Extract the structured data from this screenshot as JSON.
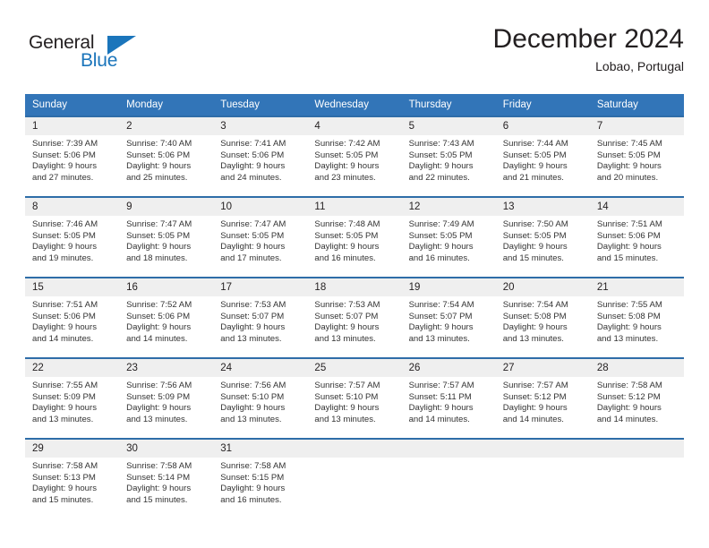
{
  "brand": {
    "name_part1": "General",
    "name_part2": "Blue"
  },
  "header": {
    "title": "December 2024",
    "location": "Lobao, Portugal"
  },
  "calendar": {
    "weekday_headers": [
      "Sunday",
      "Monday",
      "Tuesday",
      "Wednesday",
      "Thursday",
      "Friday",
      "Saturday"
    ],
    "colors": {
      "header_blue": "#3275b8",
      "row_divider_blue": "#2e6da8",
      "daynum_band": "#efefef",
      "brand_blue": "#1b75bb"
    },
    "weeks": [
      [
        {
          "day": "1",
          "sunrise": "Sunrise: 7:39 AM",
          "sunset": "Sunset: 5:06 PM",
          "daylight_line1": "Daylight: 9 hours",
          "daylight_line2": "and 27 minutes."
        },
        {
          "day": "2",
          "sunrise": "Sunrise: 7:40 AM",
          "sunset": "Sunset: 5:06 PM",
          "daylight_line1": "Daylight: 9 hours",
          "daylight_line2": "and 25 minutes."
        },
        {
          "day": "3",
          "sunrise": "Sunrise: 7:41 AM",
          "sunset": "Sunset: 5:06 PM",
          "daylight_line1": "Daylight: 9 hours",
          "daylight_line2": "and 24 minutes."
        },
        {
          "day": "4",
          "sunrise": "Sunrise: 7:42 AM",
          "sunset": "Sunset: 5:05 PM",
          "daylight_line1": "Daylight: 9 hours",
          "daylight_line2": "and 23 minutes."
        },
        {
          "day": "5",
          "sunrise": "Sunrise: 7:43 AM",
          "sunset": "Sunset: 5:05 PM",
          "daylight_line1": "Daylight: 9 hours",
          "daylight_line2": "and 22 minutes."
        },
        {
          "day": "6",
          "sunrise": "Sunrise: 7:44 AM",
          "sunset": "Sunset: 5:05 PM",
          "daylight_line1": "Daylight: 9 hours",
          "daylight_line2": "and 21 minutes."
        },
        {
          "day": "7",
          "sunrise": "Sunrise: 7:45 AM",
          "sunset": "Sunset: 5:05 PM",
          "daylight_line1": "Daylight: 9 hours",
          "daylight_line2": "and 20 minutes."
        }
      ],
      [
        {
          "day": "8",
          "sunrise": "Sunrise: 7:46 AM",
          "sunset": "Sunset: 5:05 PM",
          "daylight_line1": "Daylight: 9 hours",
          "daylight_line2": "and 19 minutes."
        },
        {
          "day": "9",
          "sunrise": "Sunrise: 7:47 AM",
          "sunset": "Sunset: 5:05 PM",
          "daylight_line1": "Daylight: 9 hours",
          "daylight_line2": "and 18 minutes."
        },
        {
          "day": "10",
          "sunrise": "Sunrise: 7:47 AM",
          "sunset": "Sunset: 5:05 PM",
          "daylight_line1": "Daylight: 9 hours",
          "daylight_line2": "and 17 minutes."
        },
        {
          "day": "11",
          "sunrise": "Sunrise: 7:48 AM",
          "sunset": "Sunset: 5:05 PM",
          "daylight_line1": "Daylight: 9 hours",
          "daylight_line2": "and 16 minutes."
        },
        {
          "day": "12",
          "sunrise": "Sunrise: 7:49 AM",
          "sunset": "Sunset: 5:05 PM",
          "daylight_line1": "Daylight: 9 hours",
          "daylight_line2": "and 16 minutes."
        },
        {
          "day": "13",
          "sunrise": "Sunrise: 7:50 AM",
          "sunset": "Sunset: 5:05 PM",
          "daylight_line1": "Daylight: 9 hours",
          "daylight_line2": "and 15 minutes."
        },
        {
          "day": "14",
          "sunrise": "Sunrise: 7:51 AM",
          "sunset": "Sunset: 5:06 PM",
          "daylight_line1": "Daylight: 9 hours",
          "daylight_line2": "and 15 minutes."
        }
      ],
      [
        {
          "day": "15",
          "sunrise": "Sunrise: 7:51 AM",
          "sunset": "Sunset: 5:06 PM",
          "daylight_line1": "Daylight: 9 hours",
          "daylight_line2": "and 14 minutes."
        },
        {
          "day": "16",
          "sunrise": "Sunrise: 7:52 AM",
          "sunset": "Sunset: 5:06 PM",
          "daylight_line1": "Daylight: 9 hours",
          "daylight_line2": "and 14 minutes."
        },
        {
          "day": "17",
          "sunrise": "Sunrise: 7:53 AM",
          "sunset": "Sunset: 5:07 PM",
          "daylight_line1": "Daylight: 9 hours",
          "daylight_line2": "and 13 minutes."
        },
        {
          "day": "18",
          "sunrise": "Sunrise: 7:53 AM",
          "sunset": "Sunset: 5:07 PM",
          "daylight_line1": "Daylight: 9 hours",
          "daylight_line2": "and 13 minutes."
        },
        {
          "day": "19",
          "sunrise": "Sunrise: 7:54 AM",
          "sunset": "Sunset: 5:07 PM",
          "daylight_line1": "Daylight: 9 hours",
          "daylight_line2": "and 13 minutes."
        },
        {
          "day": "20",
          "sunrise": "Sunrise: 7:54 AM",
          "sunset": "Sunset: 5:08 PM",
          "daylight_line1": "Daylight: 9 hours",
          "daylight_line2": "and 13 minutes."
        },
        {
          "day": "21",
          "sunrise": "Sunrise: 7:55 AM",
          "sunset": "Sunset: 5:08 PM",
          "daylight_line1": "Daylight: 9 hours",
          "daylight_line2": "and 13 minutes."
        }
      ],
      [
        {
          "day": "22",
          "sunrise": "Sunrise: 7:55 AM",
          "sunset": "Sunset: 5:09 PM",
          "daylight_line1": "Daylight: 9 hours",
          "daylight_line2": "and 13 minutes."
        },
        {
          "day": "23",
          "sunrise": "Sunrise: 7:56 AM",
          "sunset": "Sunset: 5:09 PM",
          "daylight_line1": "Daylight: 9 hours",
          "daylight_line2": "and 13 minutes."
        },
        {
          "day": "24",
          "sunrise": "Sunrise: 7:56 AM",
          "sunset": "Sunset: 5:10 PM",
          "daylight_line1": "Daylight: 9 hours",
          "daylight_line2": "and 13 minutes."
        },
        {
          "day": "25",
          "sunrise": "Sunrise: 7:57 AM",
          "sunset": "Sunset: 5:10 PM",
          "daylight_line1": "Daylight: 9 hours",
          "daylight_line2": "and 13 minutes."
        },
        {
          "day": "26",
          "sunrise": "Sunrise: 7:57 AM",
          "sunset": "Sunset: 5:11 PM",
          "daylight_line1": "Daylight: 9 hours",
          "daylight_line2": "and 14 minutes."
        },
        {
          "day": "27",
          "sunrise": "Sunrise: 7:57 AM",
          "sunset": "Sunset: 5:12 PM",
          "daylight_line1": "Daylight: 9 hours",
          "daylight_line2": "and 14 minutes."
        },
        {
          "day": "28",
          "sunrise": "Sunrise: 7:58 AM",
          "sunset": "Sunset: 5:12 PM",
          "daylight_line1": "Daylight: 9 hours",
          "daylight_line2": "and 14 minutes."
        }
      ],
      [
        {
          "day": "29",
          "sunrise": "Sunrise: 7:58 AM",
          "sunset": "Sunset: 5:13 PM",
          "daylight_line1": "Daylight: 9 hours",
          "daylight_line2": "and 15 minutes."
        },
        {
          "day": "30",
          "sunrise": "Sunrise: 7:58 AM",
          "sunset": "Sunset: 5:14 PM",
          "daylight_line1": "Daylight: 9 hours",
          "daylight_line2": "and 15 minutes."
        },
        {
          "day": "31",
          "sunrise": "Sunrise: 7:58 AM",
          "sunset": "Sunset: 5:15 PM",
          "daylight_line1": "Daylight: 9 hours",
          "daylight_line2": "and 16 minutes."
        },
        {
          "day": "",
          "sunrise": "",
          "sunset": "",
          "daylight_line1": "",
          "daylight_line2": ""
        },
        {
          "day": "",
          "sunrise": "",
          "sunset": "",
          "daylight_line1": "",
          "daylight_line2": ""
        },
        {
          "day": "",
          "sunrise": "",
          "sunset": "",
          "daylight_line1": "",
          "daylight_line2": ""
        },
        {
          "day": "",
          "sunrise": "",
          "sunset": "",
          "daylight_line1": "",
          "daylight_line2": ""
        }
      ]
    ]
  }
}
